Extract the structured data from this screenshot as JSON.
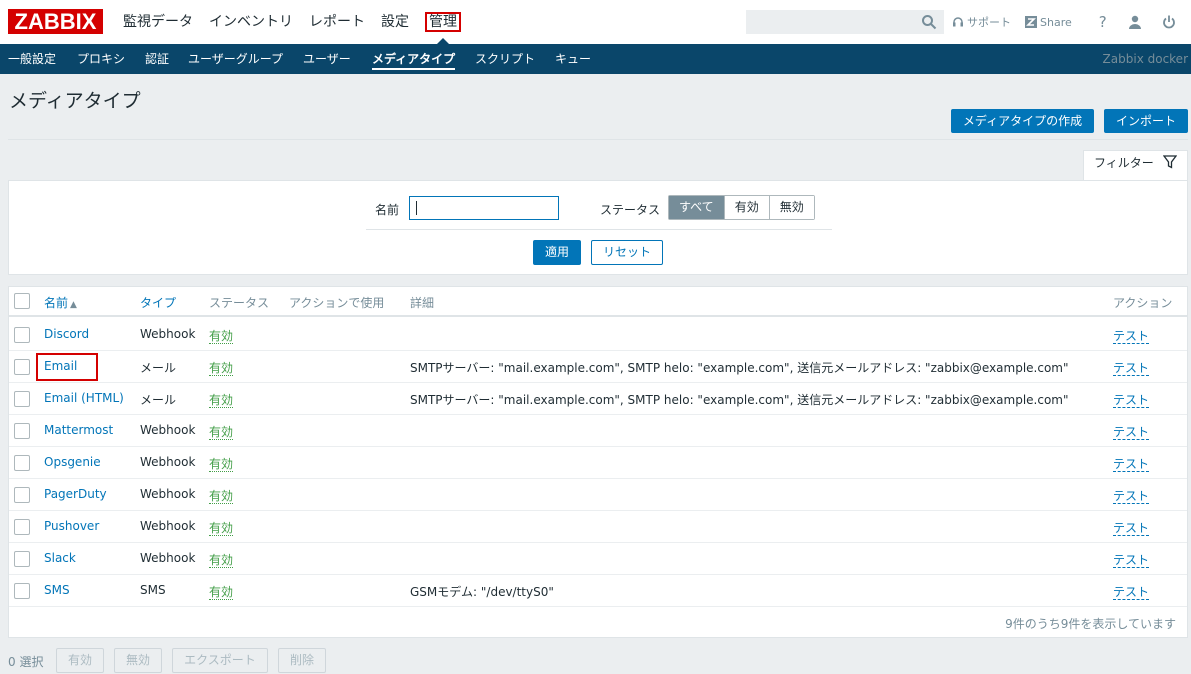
{
  "header": {
    "logo": "ZABBIX",
    "menu": [
      "監視データ",
      "インベントリ",
      "レポート",
      "設定",
      "管理"
    ],
    "search_placeholder": "",
    "support": "サポート",
    "share": "Share",
    "help": "?",
    "server_name": "Zabbix docker"
  },
  "subnav": [
    "一般設定",
    "プロキシ",
    "認証",
    "ユーザーグループ",
    "ユーザー",
    "メディアタイプ",
    "スクリプト",
    "キュー"
  ],
  "page": {
    "title": "メディアタイプ",
    "create_button": "メディアタイプの作成",
    "import_button": "インポート"
  },
  "filter": {
    "tab_label": "フィルター",
    "name_label": "名前",
    "name_value": "",
    "status_label": "ステータス",
    "status_options": [
      "すべて",
      "有効",
      "無効"
    ],
    "status_selected": "すべて",
    "apply": "適用",
    "reset": "リセット"
  },
  "table": {
    "columns": {
      "name": "名前",
      "sort_arrow": "▲",
      "type": "タイプ",
      "status": "ステータス",
      "used_in": "アクションで使用",
      "details": "詳細",
      "action": "アクション"
    },
    "rows": [
      {
        "name": "Discord",
        "type": "Webhook",
        "status": "有効",
        "details": "",
        "action": "テスト"
      },
      {
        "name": "Email",
        "type": "メール",
        "status": "有効",
        "details": "SMTPサーバー: \"mail.example.com\", SMTP helo: \"example.com\", 送信元メールアドレス: \"zabbix@example.com\"",
        "action": "テスト"
      },
      {
        "name": "Email (HTML)",
        "type": "メール",
        "status": "有効",
        "details": "SMTPサーバー: \"mail.example.com\", SMTP helo: \"example.com\", 送信元メールアドレス: \"zabbix@example.com\"",
        "action": "テスト"
      },
      {
        "name": "Mattermost",
        "type": "Webhook",
        "status": "有効",
        "details": "",
        "action": "テスト"
      },
      {
        "name": "Opsgenie",
        "type": "Webhook",
        "status": "有効",
        "details": "",
        "action": "テスト"
      },
      {
        "name": "PagerDuty",
        "type": "Webhook",
        "status": "有効",
        "details": "",
        "action": "テスト"
      },
      {
        "name": "Pushover",
        "type": "Webhook",
        "status": "有効",
        "details": "",
        "action": "テスト"
      },
      {
        "name": "Slack",
        "type": "Webhook",
        "status": "有効",
        "details": "",
        "action": "テスト"
      },
      {
        "name": "SMS",
        "type": "SMS",
        "status": "有効",
        "details": "GSMモデム: \"/dev/ttyS0\"",
        "action": "テスト"
      }
    ],
    "paging": "9件のうち9件を表示しています"
  },
  "footer": {
    "selected": "0 選択",
    "buttons": [
      "有効",
      "無効",
      "エクスポート",
      "削除"
    ]
  },
  "colors": {
    "logo": "#d40000",
    "subnav": "#0a466a",
    "primary": "#0275b8",
    "enabled": "#429e47",
    "highlight": "#d40000"
  }
}
